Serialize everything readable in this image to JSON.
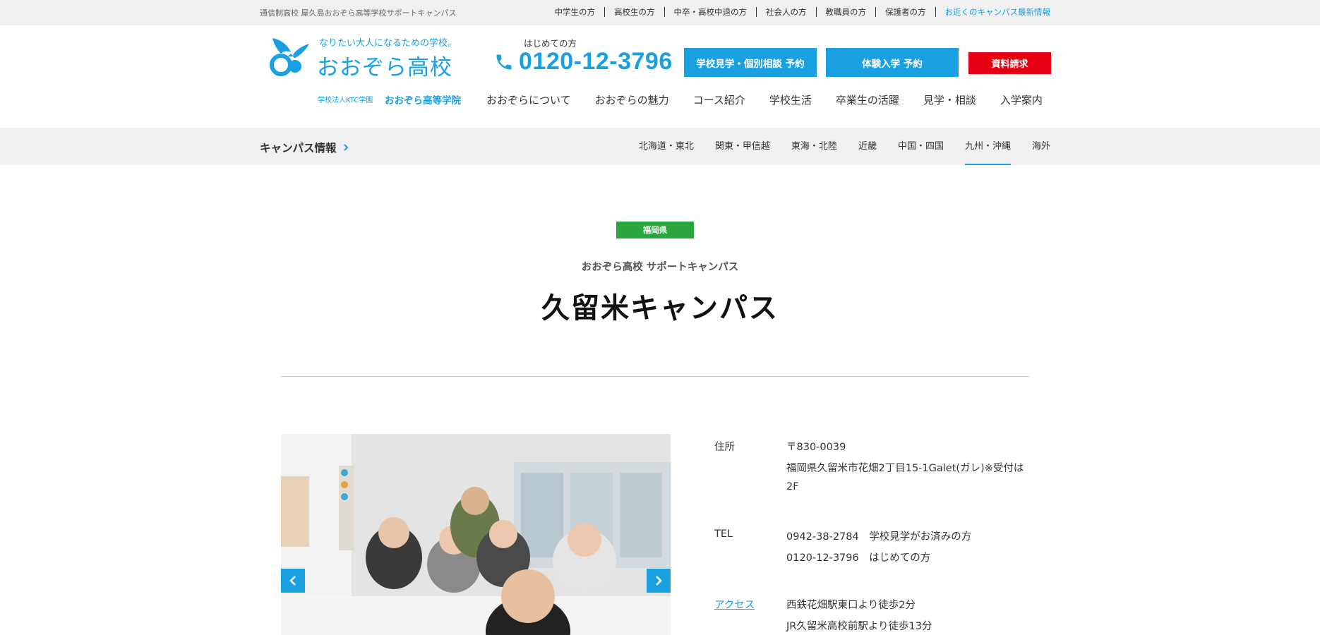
{
  "topbar": {
    "tagline": "通信制高校 屋久島おおぞら高等学校サポートキャンパス",
    "links": [
      "中学生の方",
      "高校生の方",
      "中卒・高校中退の方",
      "社会人の方",
      "教職員の方",
      "保護者の方",
      "お近くのキャンパス最新情報"
    ]
  },
  "logo": {
    "tagline": "なりたい大人になるための学校。",
    "name": "おおぞら高校",
    "corp": "学校法人KTC学園",
    "corp_name": "おおぞら高等学院"
  },
  "phone": {
    "label": "はじめての方",
    "number": "0120-12-3796",
    "icon": "phone-icon"
  },
  "buttons": {
    "visit": "学校見学・個別相談 予約",
    "trial": "体験入学 予約",
    "request": "資料請求"
  },
  "mainnav": [
    "おおぞらについて",
    "おおぞらの魅力",
    "コース紹介",
    "学校生活",
    "卒業生の活躍",
    "見学・相談",
    "入学案内"
  ],
  "subnav": {
    "title": "キャンパス情報",
    "regions": [
      "北海道・東北",
      "関東・甲信越",
      "東海・北陸",
      "近畿",
      "中国・四国",
      "九州・沖縄",
      "海外"
    ],
    "active": "九州・沖縄"
  },
  "campus": {
    "prefecture": "福岡県",
    "subtitle": "おおぞら高校 サポートキャンパス",
    "title": "久留米キャンパス"
  },
  "info": {
    "address_label": "住所",
    "postal": "〒830-0039",
    "address_line1": "福岡県久留米市花畑2丁目15-1Galet(ガレ)※受付は",
    "address_line2": "2F",
    "tel_label": "TEL",
    "tel_line1": "0942-38-2784　学校見学がお済みの方",
    "tel_line2": "0120-12-3796　はじめての方",
    "access_label": "アクセス",
    "access_line1": "西鉄花畑駅東口より徒歩2分",
    "access_line2": "JR久留米高校前駅より徒歩13分"
  },
  "colors": {
    "brand_blue": "#1aa0e0",
    "request_red": "#e60012",
    "badge_green": "#2aa63c"
  }
}
